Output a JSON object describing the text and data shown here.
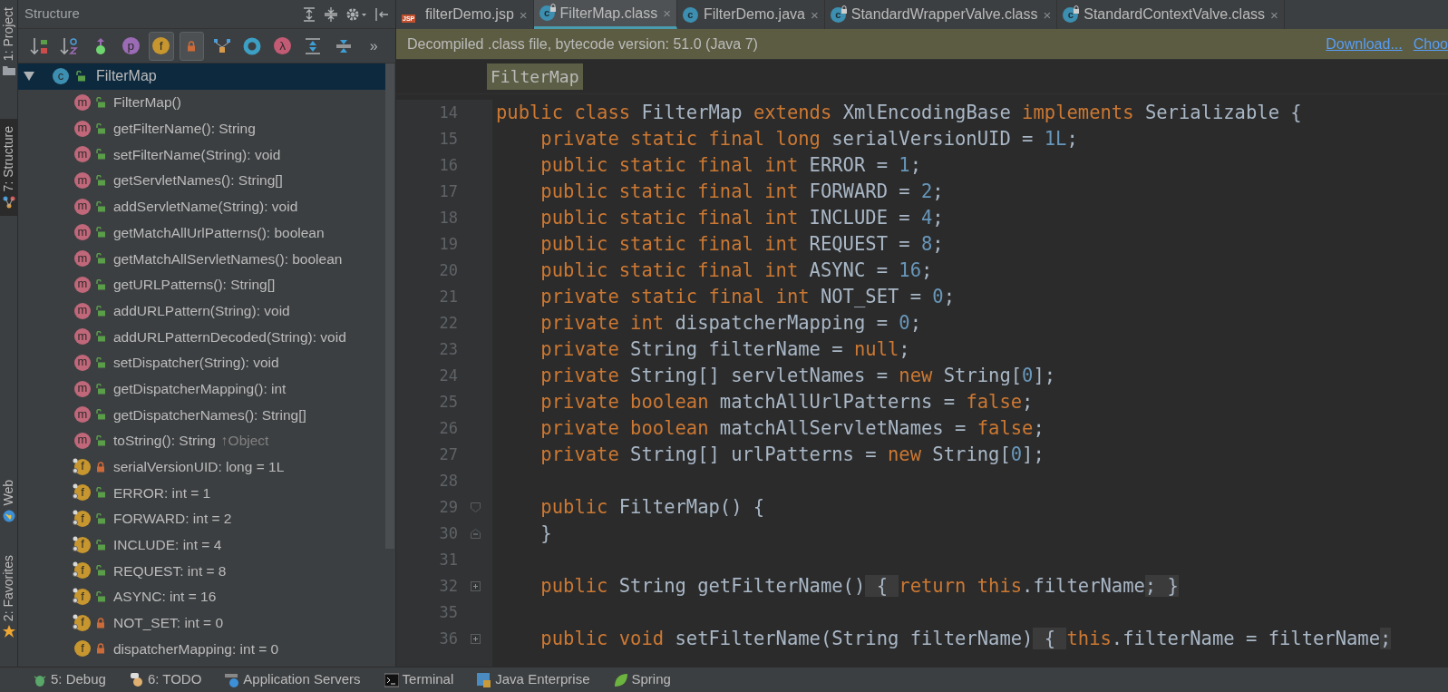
{
  "side_stripe": [
    {
      "label": "1: Project",
      "kind": "folder",
      "selected": false
    },
    {
      "label": "7: Structure",
      "kind": "structure",
      "selected": true
    },
    {
      "label": "Web",
      "kind": "globe",
      "selected": false
    },
    {
      "label": "2: Favorites",
      "kind": "star",
      "selected": false
    }
  ],
  "structure": {
    "title": "Structure",
    "header_actions": [
      {
        "kind": "expand"
      },
      {
        "kind": "collapse"
      },
      {
        "kind": "gear"
      },
      {
        "kind": "hide"
      }
    ],
    "toolbar": [
      {
        "kind": "sort-visibility",
        "on": false
      },
      {
        "kind": "sort-alpha",
        "on": false
      },
      {
        "kind": "inherited",
        "on": false
      },
      {
        "kind": "badge",
        "glyph": "p",
        "color": "#9b6bb5",
        "on": false
      },
      {
        "kind": "badge",
        "glyph": "f",
        "color": "#c7962e",
        "on": true
      },
      {
        "kind": "lock",
        "on": true
      },
      {
        "kind": "hierarchy",
        "on": false
      },
      {
        "kind": "ring",
        "on": false
      },
      {
        "kind": "badge",
        "glyph": "λ",
        "color": "#c35b75",
        "on": false
      },
      {
        "kind": "expand",
        "on": false
      },
      {
        "kind": "collapse",
        "on": false
      },
      {
        "kind": "more",
        "glyph": "»",
        "on": false
      }
    ],
    "tree": {
      "label": "FilterMap",
      "badge": "c",
      "private": false,
      "expanded": true,
      "selected": true,
      "children": [
        {
          "kind": "method",
          "badge": "m",
          "private": false,
          "static": false,
          "label": "FilterMap()"
        },
        {
          "kind": "method",
          "badge": "m",
          "private": false,
          "static": false,
          "label": "getFilterName(): String"
        },
        {
          "kind": "method",
          "badge": "m",
          "private": false,
          "static": false,
          "label": "setFilterName(String): void"
        },
        {
          "kind": "method",
          "badge": "m",
          "private": false,
          "static": false,
          "label": "getServletNames(): String[]"
        },
        {
          "kind": "method",
          "badge": "m",
          "private": false,
          "static": false,
          "label": "addServletName(String): void"
        },
        {
          "kind": "method",
          "badge": "m",
          "private": false,
          "static": false,
          "label": "getMatchAllUrlPatterns(): boolean"
        },
        {
          "kind": "method",
          "badge": "m",
          "private": false,
          "static": false,
          "label": "getMatchAllServletNames(): boolean"
        },
        {
          "kind": "method",
          "badge": "m",
          "private": false,
          "static": false,
          "label": "getURLPatterns(): String[]"
        },
        {
          "kind": "method",
          "badge": "m",
          "private": false,
          "static": false,
          "label": "addURLPattern(String): void"
        },
        {
          "kind": "method",
          "badge": "m",
          "private": false,
          "static": false,
          "label": "addURLPatternDecoded(String): void"
        },
        {
          "kind": "method",
          "badge": "m",
          "private": false,
          "static": false,
          "label": "setDispatcher(String): void"
        },
        {
          "kind": "method",
          "badge": "m",
          "private": false,
          "static": false,
          "label": "getDispatcherMapping(): int"
        },
        {
          "kind": "method",
          "badge": "m",
          "private": false,
          "static": false,
          "label": "getDispatcherNames(): String[]"
        },
        {
          "kind": "method",
          "badge": "m",
          "private": false,
          "static": false,
          "label": "toString(): String",
          "inherited": "↑Object"
        },
        {
          "kind": "field",
          "badge": "f",
          "private": true,
          "static": true,
          "label": "serialVersionUID: long = 1L"
        },
        {
          "kind": "field",
          "badge": "f",
          "private": false,
          "static": true,
          "label": "ERROR: int = 1"
        },
        {
          "kind": "field",
          "badge": "f",
          "private": false,
          "static": true,
          "label": "FORWARD: int = 2"
        },
        {
          "kind": "field",
          "badge": "f",
          "private": false,
          "static": true,
          "label": "INCLUDE: int = 4"
        },
        {
          "kind": "field",
          "badge": "f",
          "private": false,
          "static": true,
          "label": "REQUEST: int = 8"
        },
        {
          "kind": "field",
          "badge": "f",
          "private": false,
          "static": true,
          "label": "ASYNC: int = 16"
        },
        {
          "kind": "field",
          "badge": "f",
          "private": true,
          "static": true,
          "label": "NOT_SET: int = 0"
        },
        {
          "kind": "field",
          "badge": "f",
          "private": true,
          "static": false,
          "label": "dispatcherMapping: int = 0"
        }
      ]
    }
  },
  "editor_tabs": [
    {
      "label": "filterDemo.jsp",
      "kind": "jsp",
      "badge": "JSP",
      "locked": false,
      "selected": false,
      "close": "×"
    },
    {
      "label": "FilterMap.class",
      "kind": "class",
      "badge": "c",
      "locked": true,
      "selected": true,
      "close": "×"
    },
    {
      "label": "FilterDemo.java",
      "kind": "class",
      "badge": "c",
      "locked": false,
      "selected": false,
      "close": "×"
    },
    {
      "label": "StandardWrapperValve.class",
      "kind": "class",
      "badge": "c",
      "locked": true,
      "selected": false,
      "close": "×"
    },
    {
      "label": "StandardContextValve.class",
      "kind": "class",
      "badge": "c",
      "locked": true,
      "selected": false,
      "close": "×"
    }
  ],
  "banner": {
    "text": "Decompiled .class file, bytecode version: 51.0 (Java 7)",
    "links": [
      "Download...",
      "Choo"
    ]
  },
  "breadcrumb": "FilterMap",
  "code": [
    {
      "number": "14",
      "kind": "plain",
      "tokens": [
        {
          "kind": "kw",
          "text": "public class "
        },
        {
          "kind": "plain",
          "text": "FilterMap "
        },
        {
          "kind": "kw",
          "text": "extends "
        },
        {
          "kind": "plain",
          "text": "XmlEncodingBase "
        },
        {
          "kind": "kw",
          "text": "implements "
        },
        {
          "kind": "plain",
          "text": "Serializable {"
        }
      ]
    },
    {
      "number": "15",
      "kind": "plain",
      "tokens": [
        {
          "kind": "kw",
          "text": "    private static final long "
        },
        {
          "kind": "plain",
          "text": "serialVersionUID = "
        },
        {
          "kind": "num",
          "text": "1L"
        },
        {
          "kind": "plain",
          "text": ";"
        }
      ]
    },
    {
      "number": "16",
      "kind": "plain",
      "tokens": [
        {
          "kind": "kw",
          "text": "    public static final int "
        },
        {
          "kind": "plain",
          "text": "ERROR = "
        },
        {
          "kind": "num",
          "text": "1"
        },
        {
          "kind": "plain",
          "text": ";"
        }
      ]
    },
    {
      "number": "17",
      "kind": "plain",
      "tokens": [
        {
          "kind": "kw",
          "text": "    public static final int "
        },
        {
          "kind": "plain",
          "text": "FORWARD = "
        },
        {
          "kind": "num",
          "text": "2"
        },
        {
          "kind": "plain",
          "text": ";"
        }
      ]
    },
    {
      "number": "18",
      "kind": "plain",
      "tokens": [
        {
          "kind": "kw",
          "text": "    public static final int "
        },
        {
          "kind": "plain",
          "text": "INCLUDE = "
        },
        {
          "kind": "num",
          "text": "4"
        },
        {
          "kind": "plain",
          "text": ";"
        }
      ]
    },
    {
      "number": "19",
      "kind": "plain",
      "tokens": [
        {
          "kind": "kw",
          "text": "    public static final int "
        },
        {
          "kind": "plain",
          "text": "REQUEST = "
        },
        {
          "kind": "num",
          "text": "8"
        },
        {
          "kind": "plain",
          "text": ";"
        }
      ]
    },
    {
      "number": "20",
      "kind": "plain",
      "tokens": [
        {
          "kind": "kw",
          "text": "    public static final int "
        },
        {
          "kind": "plain",
          "text": "ASYNC = "
        },
        {
          "kind": "num",
          "text": "16"
        },
        {
          "kind": "plain",
          "text": ";"
        }
      ]
    },
    {
      "number": "21",
      "kind": "plain",
      "tokens": [
        {
          "kind": "kw",
          "text": "    private static final int "
        },
        {
          "kind": "plain",
          "text": "NOT_SET = "
        },
        {
          "kind": "num",
          "text": "0"
        },
        {
          "kind": "plain",
          "text": ";"
        }
      ]
    },
    {
      "number": "22",
      "kind": "plain",
      "tokens": [
        {
          "kind": "kw",
          "text": "    private int "
        },
        {
          "kind": "plain",
          "text": "dispatcherMapping = "
        },
        {
          "kind": "num",
          "text": "0"
        },
        {
          "kind": "plain",
          "text": ";"
        }
      ]
    },
    {
      "number": "23",
      "kind": "plain",
      "tokens": [
        {
          "kind": "kw",
          "text": "    private "
        },
        {
          "kind": "plain",
          "text": "String filterName = "
        },
        {
          "kind": "kw",
          "text": "null"
        },
        {
          "kind": "plain",
          "text": ";"
        }
      ]
    },
    {
      "number": "24",
      "kind": "plain",
      "tokens": [
        {
          "kind": "kw",
          "text": "    private "
        },
        {
          "kind": "plain",
          "text": "String[] servletNames = "
        },
        {
          "kind": "kw",
          "text": "new "
        },
        {
          "kind": "plain",
          "text": "String["
        },
        {
          "kind": "num",
          "text": "0"
        },
        {
          "kind": "plain",
          "text": "];"
        }
      ]
    },
    {
      "number": "25",
      "kind": "plain",
      "tokens": [
        {
          "kind": "kw",
          "text": "    private boolean "
        },
        {
          "kind": "plain",
          "text": "matchAllUrlPatterns = "
        },
        {
          "kind": "kw",
          "text": "false"
        },
        {
          "kind": "plain",
          "text": ";"
        }
      ]
    },
    {
      "number": "26",
      "kind": "plain",
      "tokens": [
        {
          "kind": "kw",
          "text": "    private boolean "
        },
        {
          "kind": "plain",
          "text": "matchAllServletNames = "
        },
        {
          "kind": "kw",
          "text": "false"
        },
        {
          "kind": "plain",
          "text": ";"
        }
      ]
    },
    {
      "number": "27",
      "kind": "plain",
      "tokens": [
        {
          "kind": "kw",
          "text": "    private "
        },
        {
          "kind": "plain",
          "text": "String[] urlPatterns = "
        },
        {
          "kind": "kw",
          "text": "new "
        },
        {
          "kind": "plain",
          "text": "String["
        },
        {
          "kind": "num",
          "text": "0"
        },
        {
          "kind": "plain",
          "text": "];"
        }
      ]
    },
    {
      "number": "28",
      "kind": "plain"
    },
    {
      "number": "29",
      "kind": "fold-open",
      "tokens": [
        {
          "kind": "kw",
          "text": "    public "
        },
        {
          "kind": "plain",
          "text": "FilterMap() {"
        }
      ]
    },
    {
      "number": "30",
      "kind": "fold-close",
      "tokens": [
        {
          "kind": "plain",
          "text": "    }"
        }
      ]
    },
    {
      "number": "31",
      "kind": "plain"
    },
    {
      "number": "32",
      "kind": "collapsed",
      "tokens": [
        {
          "kind": "kw",
          "text": "    public "
        },
        {
          "kind": "plain",
          "text": "String getFilterName()"
        },
        {
          "kind": "folded",
          "text": " { "
        },
        {
          "kind": "kw",
          "text": "return this"
        },
        {
          "kind": "plain",
          "text": ".filterName"
        },
        {
          "kind": "folded",
          "text": "; }"
        }
      ]
    },
    {
      "number": "35",
      "kind": "plain"
    },
    {
      "number": "36",
      "kind": "collapsed",
      "tokens": [
        {
          "kind": "kw",
          "text": "    public void "
        },
        {
          "kind": "plain",
          "text": "setFilterName(String filterName)"
        },
        {
          "kind": "folded",
          "text": " { "
        },
        {
          "kind": "kw",
          "text": "this"
        },
        {
          "kind": "plain",
          "text": ".filterName = filterName"
        },
        {
          "kind": "folded",
          "text": ";"
        }
      ]
    }
  ],
  "bottom_bar": [
    {
      "label": "5: Debug",
      "kind": "bug"
    },
    {
      "label": "6: TODO",
      "kind": "todo"
    },
    {
      "label": "Application Servers",
      "kind": "server"
    },
    {
      "label": "Terminal",
      "kind": "terminal"
    },
    {
      "label": "Java Enterprise",
      "kind": "enterprise"
    },
    {
      "label": "Spring",
      "kind": "leaf"
    }
  ]
}
